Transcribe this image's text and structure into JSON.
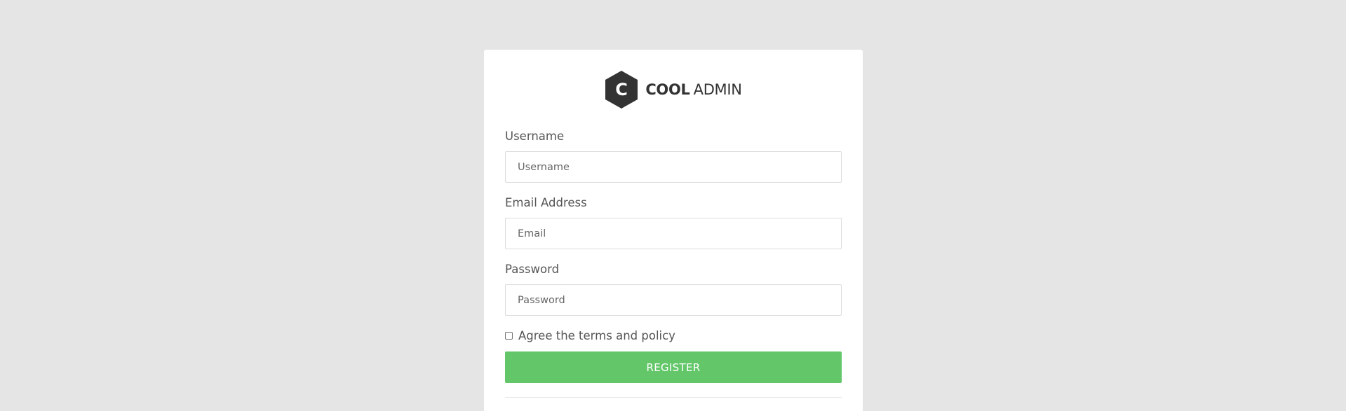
{
  "brand": {
    "logo_letter": "C",
    "name_bold": "COOL",
    "name_light": "ADMIN",
    "icon": "hexagon-logo-icon"
  },
  "form": {
    "username": {
      "label": "Username",
      "placeholder": "Username",
      "value": ""
    },
    "email": {
      "label": "Email Address",
      "placeholder": "Email",
      "value": ""
    },
    "password": {
      "label": "Password",
      "placeholder": "Password",
      "value": ""
    },
    "agree": {
      "label": "Agree the terms and policy",
      "checked": false
    },
    "register_label": "REGISTER"
  },
  "colors": {
    "background": "#e5e5e5",
    "card": "#ffffff",
    "button": "#63c76a",
    "logo": "#333333"
  }
}
